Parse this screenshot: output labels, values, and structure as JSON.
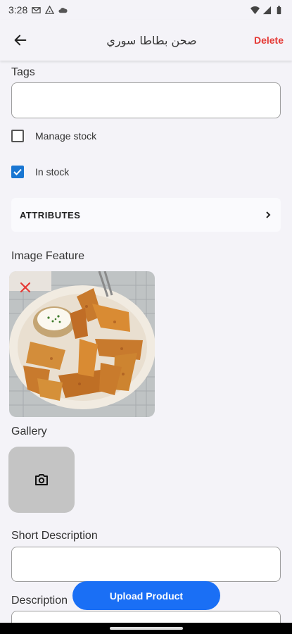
{
  "status_bar": {
    "time": "3:28",
    "icons_left": [
      "gmail-icon",
      "alert-icon",
      "cloud-icon"
    ],
    "icons_right": [
      "wifi-icon",
      "signal-icon",
      "battery-icon"
    ]
  },
  "app_bar": {
    "back_icon": "arrow-back-icon",
    "title": "صحن بطاطا سوري",
    "delete_label": "Delete",
    "delete_color": "#e53935"
  },
  "form": {
    "tags_label": "Tags",
    "tags_value": "",
    "manage_stock_label": "Manage stock",
    "manage_stock_checked": false,
    "in_stock_label": "In stock",
    "in_stock_checked": true,
    "attributes_label": "ATTRIBUTES",
    "image_feature_label": "Image Feature",
    "gallery_label": "Gallery",
    "short_description_label": "Short Description",
    "short_description_value": "",
    "description_label": "Description",
    "description_value": ""
  },
  "upload_button": {
    "label": "Upload Product",
    "color": "#1a6ff5"
  },
  "accent_color": "#1976d2"
}
